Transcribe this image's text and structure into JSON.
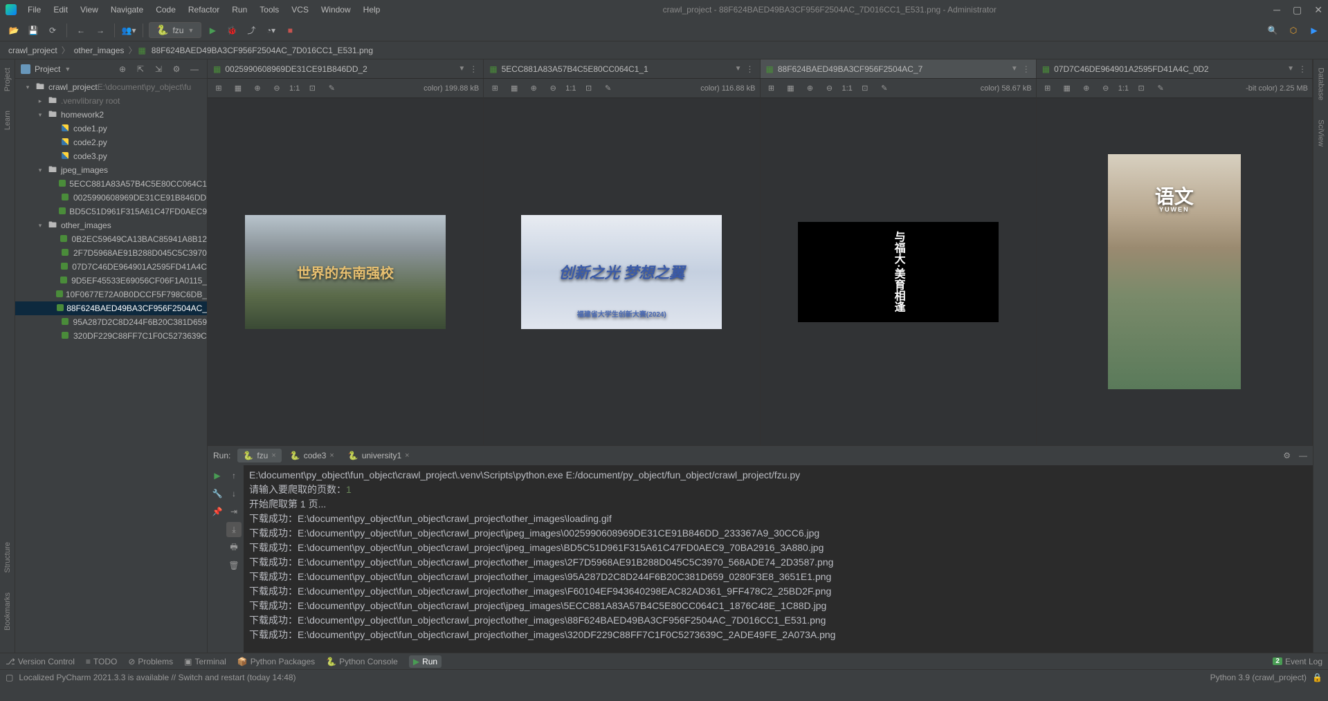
{
  "title": "crawl_project - 88F624BAED49BA3CF956F2504AC_7D016CC1_E531.png - Administrator",
  "menu": [
    "File",
    "Edit",
    "View",
    "Navigate",
    "Code",
    "Refactor",
    "Run",
    "Tools",
    "VCS",
    "Window",
    "Help"
  ],
  "run_config": "fzu",
  "breadcrumbs": [
    "crawl_project",
    "other_images",
    "88F624BAED49BA3CF956F2504AC_7D016CC1_E531.png"
  ],
  "sidebar": {
    "title": "Project",
    "tree": [
      {
        "depth": 0,
        "arrow": "▾",
        "icon": "folder",
        "label": "crawl_project",
        "suffix": " E:\\document\\py_object\\fu"
      },
      {
        "depth": 1,
        "arrow": "▸",
        "icon": "folder",
        "label": ".venv",
        "suffix": " library root",
        "muted": true
      },
      {
        "depth": 1,
        "arrow": "▾",
        "icon": "folder",
        "label": "homework2"
      },
      {
        "depth": 2,
        "arrow": "",
        "icon": "py",
        "label": "code1.py"
      },
      {
        "depth": 2,
        "arrow": "",
        "icon": "py",
        "label": "code2.py"
      },
      {
        "depth": 2,
        "arrow": "",
        "icon": "py",
        "label": "code3.py"
      },
      {
        "depth": 1,
        "arrow": "▾",
        "icon": "folder",
        "label": "jpeg_images"
      },
      {
        "depth": 2,
        "arrow": "",
        "icon": "img",
        "label": "5ECC881A83A57B4C5E80CC064C1"
      },
      {
        "depth": 2,
        "arrow": "",
        "icon": "img",
        "label": "0025990608969DE31CE91B846DD"
      },
      {
        "depth": 2,
        "arrow": "",
        "icon": "img",
        "label": "BD5C51D961F315A61C47FD0AEC9"
      },
      {
        "depth": 1,
        "arrow": "▾",
        "icon": "folder",
        "label": "other_images"
      },
      {
        "depth": 2,
        "arrow": "",
        "icon": "img",
        "label": "0B2EC59649CA13BAC85941A8B12"
      },
      {
        "depth": 2,
        "arrow": "",
        "icon": "img",
        "label": "2F7D5968AE91B288D045C5C3970"
      },
      {
        "depth": 2,
        "arrow": "",
        "icon": "img",
        "label": "07D7C46DE964901A2595FD41A4C"
      },
      {
        "depth": 2,
        "arrow": "",
        "icon": "img",
        "label": "9D5EF45533E69056CF06F1A0115_"
      },
      {
        "depth": 2,
        "arrow": "",
        "icon": "img",
        "label": "10F0677E72A0B0DCCF5F798C6DB_"
      },
      {
        "depth": 2,
        "arrow": "",
        "icon": "img",
        "label": "88F624BAED49BA3CF956F2504AC_",
        "selected": true
      },
      {
        "depth": 2,
        "arrow": "",
        "icon": "img",
        "label": "95A287D2C8D244F6B20C381D659"
      },
      {
        "depth": 2,
        "arrow": "",
        "icon": "img",
        "label": "320DF229C88FF7C1F0C5273639C"
      }
    ]
  },
  "editor_tabs": [
    {
      "name": "0025990608969DE31CE91B846DD_2",
      "info": "color) 199.88 kB",
      "active": false
    },
    {
      "name": "5ECC881A83A57B4C5E80CC064C1_1",
      "info": "color) 116.88 kB",
      "active": false
    },
    {
      "name": "88F624BAED49BA3CF956F2504AC_7",
      "info": "color) 58.67 kB",
      "active": true
    },
    {
      "name": "07D7C46DE964901A2595FD41A4C_0D2",
      "info": "-bit color) 2.25 MB",
      "active": false
    }
  ],
  "image_labels": {
    "ratio": "1:1",
    "img1_main": "世界的东南强校",
    "img2_main": "创新之光 梦想之翼",
    "img2_sub": "福建省大学生创新大赛(2024)",
    "img3_main": "与福大·美育相逢",
    "img4_main": "语文",
    "img4_sub": "YUWEN"
  },
  "run_panel": {
    "label": "Run:",
    "tabs": [
      {
        "name": "fzu",
        "active": true
      },
      {
        "name": "code3",
        "active": false
      },
      {
        "name": "university1",
        "active": false
      }
    ],
    "console": [
      "E:\\document\\py_object\\fun_object\\crawl_project\\.venv\\Scripts\\python.exe E:/document/py_object/fun_object/crawl_project/fzu.py",
      "请输入要爬取的页数：1",
      "开始爬取第 1 页...",
      "下载成功：E:\\document\\py_object\\fun_object\\crawl_project\\other_images\\loading.gif",
      "下载成功：E:\\document\\py_object\\fun_object\\crawl_project\\jpeg_images\\0025990608969DE31CE91B846DD_233367A9_30CC6.jpg",
      "下载成功：E:\\document\\py_object\\fun_object\\crawl_project\\jpeg_images\\BD5C51D961F315A61C47FD0AEC9_70BA2916_3A880.jpg",
      "下载成功：E:\\document\\py_object\\fun_object\\crawl_project\\other_images\\2F7D5968AE91B288D045C5C3970_568ADE74_2D3587.png",
      "下载成功：E:\\document\\py_object\\fun_object\\crawl_project\\other_images\\95A287D2C8D244F6B20C381D659_0280F3E8_3651E1.png",
      "下载成功：E:\\document\\py_object\\fun_object\\crawl_project\\other_images\\F60104EF943640298EAC82AD361_9FF478C2_25BD2F.png",
      "下载成功：E:\\document\\py_object\\fun_object\\crawl_project\\jpeg_images\\5ECC881A83A57B4C5E80CC064C1_1876C48E_1C88D.jpg",
      "下载成功：E:\\document\\py_object\\fun_object\\crawl_project\\other_images\\88F624BAED49BA3CF956F2504AC_7D016CC1_E531.png",
      "下载成功：E:\\document\\py_object\\fun_object\\crawl_project\\other_images\\320DF229C88FF7C1F0C5273639C_2ADE49FE_2A073A.png"
    ]
  },
  "bottom_tabs": [
    "Version Control",
    "TODO",
    "Problems",
    "Terminal",
    "Python Packages",
    "Python Console",
    "Run"
  ],
  "event_log": "Event Log",
  "event_badge": "2",
  "status": {
    "left": "Localized PyCharm 2021.3.3 is available // Switch and restart (today 14:48)",
    "link": "Switch and restart",
    "right": "Python 3.9 (crawl_project)"
  },
  "left_gutter": [
    "Project",
    "Learn",
    "Structure",
    "Bookmarks"
  ],
  "right_gutter": [
    "Database",
    "SciView"
  ]
}
